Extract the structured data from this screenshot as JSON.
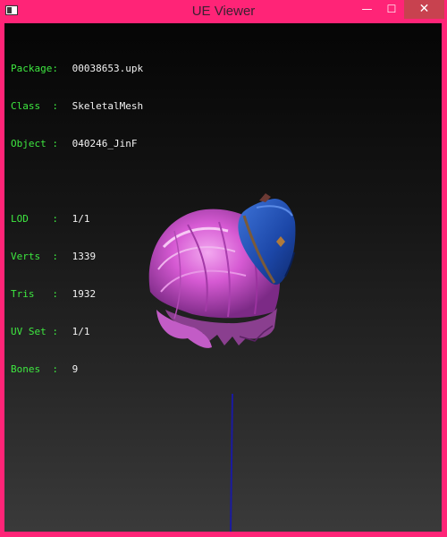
{
  "window": {
    "title": "UE Viewer",
    "controls": {
      "minimize": "—",
      "maximize": "☐",
      "close": "✕"
    }
  },
  "info": {
    "object_info": [
      {
        "key": "Package:",
        "value": "00038653.upk"
      },
      {
        "key": "Class  :",
        "value": "SkeletalMesh"
      },
      {
        "key": "Object :",
        "value": "040246_JinF"
      }
    ],
    "mesh_stats": [
      {
        "key": "LOD    :",
        "value": "1/1"
      },
      {
        "key": "Verts  :",
        "value": "1339"
      },
      {
        "key": "Tris   :",
        "value": "1932"
      },
      {
        "key": "UV Set :",
        "value": "1/1"
      },
      {
        "key": "Bones  :",
        "value": "9"
      }
    ]
  },
  "colors": {
    "frame": "#ff2477",
    "close_button": "#c8424f",
    "label_text": "#3ee840",
    "value_text": "#f2f2f2",
    "hair": "#d95fd6",
    "hat": "#1f4fb8",
    "axis_line": "#1a1aa0"
  }
}
